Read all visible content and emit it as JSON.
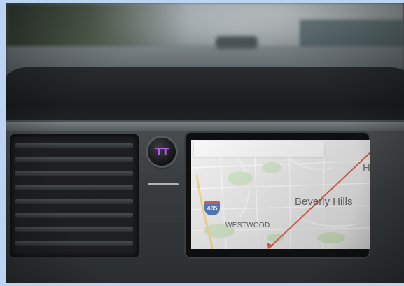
{
  "photo": {
    "subject": "car-dashboard-navigation"
  },
  "logo_button": {
    "label": "TT",
    "icon": "brand-logo-icon",
    "color": "#b35ce8"
  },
  "map": {
    "highway_shield": "405",
    "labels": {
      "westwood": "WESTWOOD",
      "beverly_hills": "Beverly Hills",
      "edge_letter": "H"
    },
    "route_color": "#e0553c"
  }
}
